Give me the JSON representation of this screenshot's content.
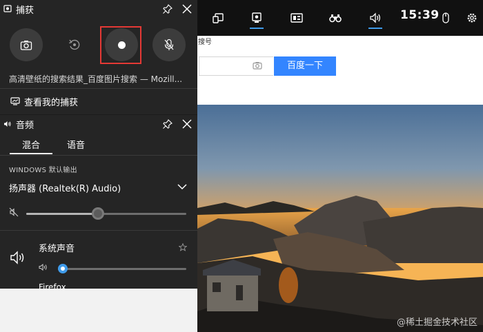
{
  "gamebar": {
    "clock": "15:39",
    "icons": [
      "widget-menu-icon",
      "capture-icon",
      "performance-icon",
      "binoculars-icon",
      "audio-icon",
      "mouse-icon",
      "settings-icon"
    ],
    "active": [
      "capture-icon",
      "audio-icon"
    ],
    "accent": "#3f9bea"
  },
  "browser": {
    "partial_label": "搜号",
    "search_button": "百度一下",
    "button_color": "#3385ff"
  },
  "watermark": "@稀土掘金技术社区",
  "capture": {
    "title": "捕获",
    "buttons": [
      "screenshot",
      "record-last-30s",
      "start-recording",
      "mic-toggle"
    ],
    "window_title": "高清壁纸的搜索结果_百度图片搜索 — Mozill...",
    "view_captures": "查看我的捕获",
    "highlight_color": "#e53935"
  },
  "audio": {
    "title": "音频",
    "tabs": [
      "混合",
      "语音"
    ],
    "active_tab": "混合",
    "default_output_label": "WINDOWS 默认输出",
    "device": "扬声器 (Realtek(R) Audio)",
    "master_volume": 0.45,
    "apps": [
      {
        "name": "系统声音",
        "volume": 0.02
      },
      {
        "name": "Firefox"
      }
    ]
  }
}
